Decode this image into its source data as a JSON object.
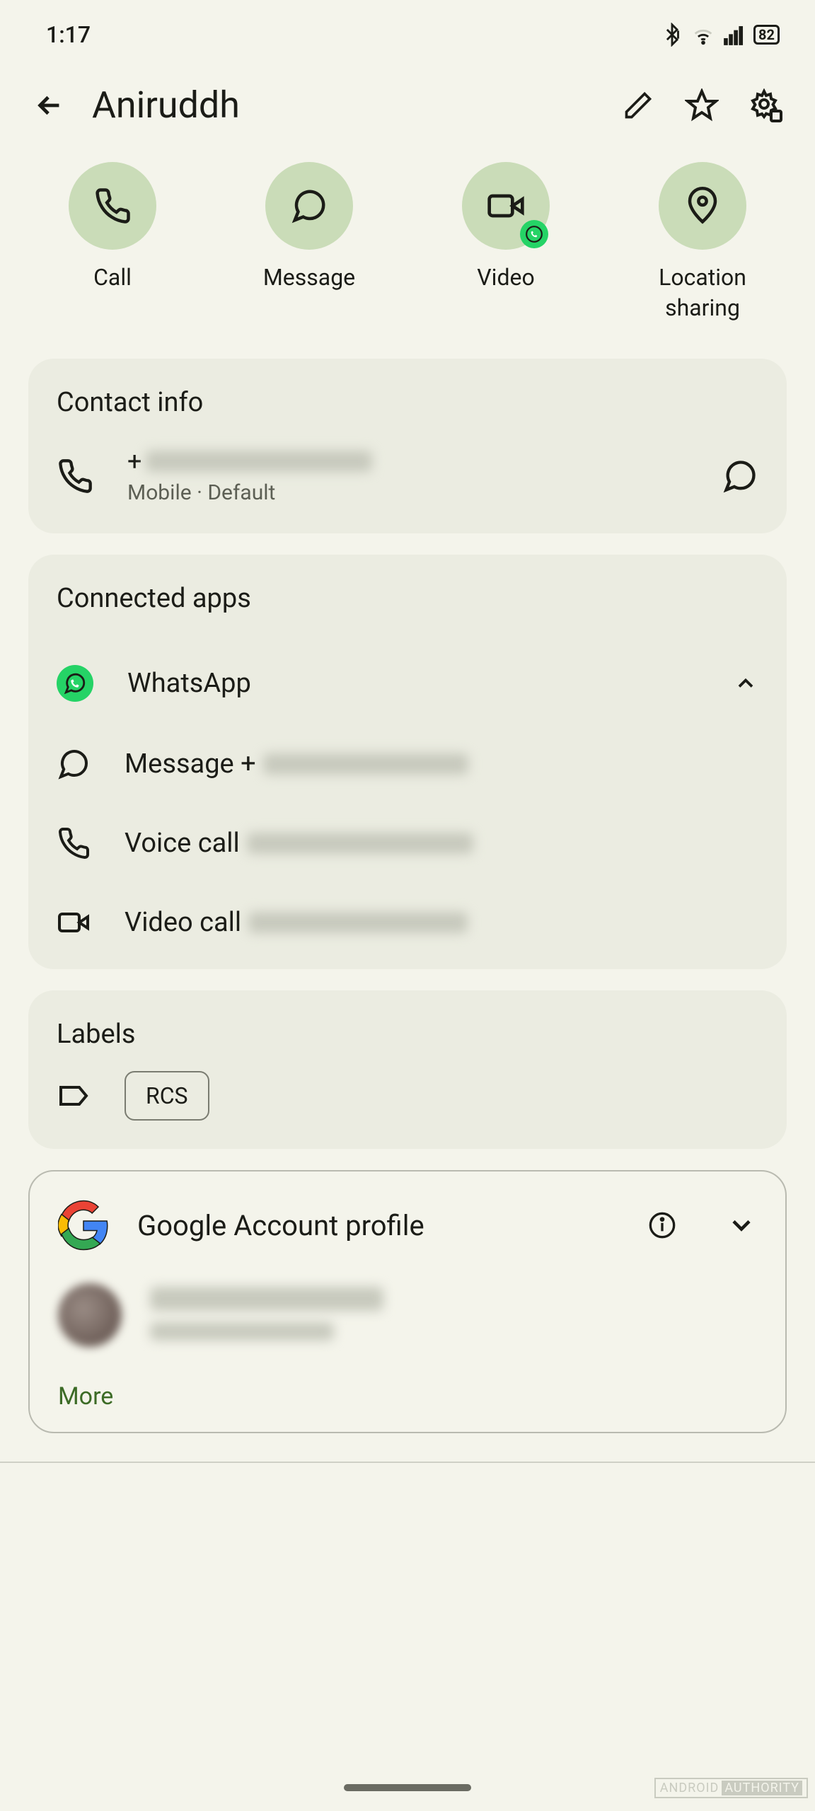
{
  "status": {
    "time": "1:17",
    "battery": "82"
  },
  "header": {
    "title": "Aniruddh"
  },
  "actions": [
    {
      "label": "Call"
    },
    {
      "label": "Message"
    },
    {
      "label": "Video"
    },
    {
      "label": "Location\nsharing"
    }
  ],
  "contact_info": {
    "title": "Contact info",
    "phone_prefix": "+",
    "phone_type": "Mobile · Default"
  },
  "connected_apps": {
    "title": "Connected apps",
    "app_name": "WhatsApp",
    "msg_label": "Message +",
    "voice_label": "Voice call ",
    "video_label": "Video call "
  },
  "labels": {
    "title": "Labels",
    "chip": "RCS"
  },
  "google": {
    "title": "Google Account profile",
    "more": "More"
  },
  "watermark": {
    "a": "ANDROID",
    "b": "AUTHORITY"
  }
}
